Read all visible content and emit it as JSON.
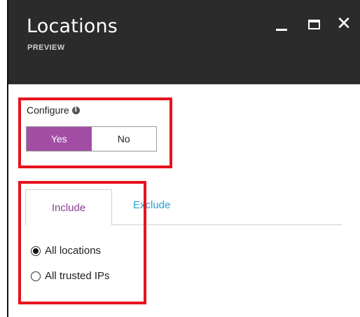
{
  "window": {
    "title": "Locations",
    "subtitle": "PREVIEW"
  },
  "configure": {
    "label": "Configure",
    "info_glyph": "i",
    "options": [
      "Yes",
      "No"
    ],
    "selected": "Yes",
    "selected_color": "#a24ea4"
  },
  "tabs": {
    "items": [
      {
        "label": "Include",
        "active": true
      },
      {
        "label": "Exclude",
        "active": false
      }
    ]
  },
  "radios": {
    "items": [
      {
        "label": "All locations",
        "checked": true
      },
      {
        "label": "All trusted IPs",
        "checked": false
      }
    ]
  },
  "colors": {
    "header_bg": "#2b2b2b",
    "accent_purple": "#8a3f95",
    "link_blue": "#2a9fd8",
    "highlight_red": "#e8121e"
  },
  "icons": {
    "minimize": "minimize-icon",
    "maximize": "maximize-icon",
    "close": "close-icon",
    "info": "info-icon"
  }
}
